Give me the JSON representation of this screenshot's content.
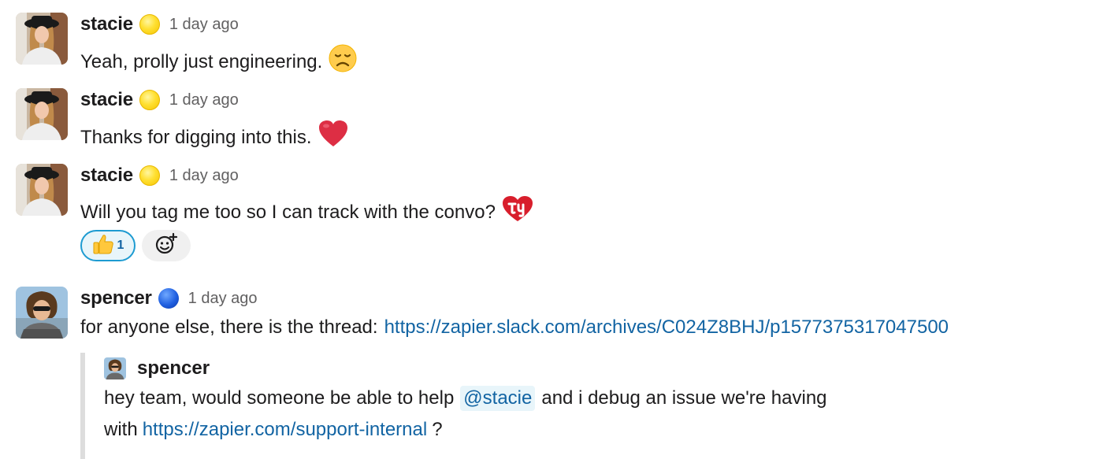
{
  "messages": [
    {
      "author": "stacie",
      "time": "1 day ago",
      "text": "Yeah, prolly just engineering."
    },
    {
      "author": "stacie",
      "time": "1 day ago",
      "text": "Thanks for digging into this."
    },
    {
      "author": "stacie",
      "time": "1 day ago",
      "text": "Will you tag me too so I can track with the convo?",
      "reactions": [
        {
          "emoji": "thumbs-up",
          "count": "1"
        }
      ]
    },
    {
      "author": "spencer",
      "time": "1 day ago",
      "text": "for anyone else, there is the thread:",
      "link": "https://zapier.slack.com/archives/C024Z8BHJ/p1577375317047500"
    }
  ],
  "quote": {
    "author": "spencer",
    "line1_pre": "hey team, would someone be able to help",
    "mention": "@stacie",
    "line1_post": "and i debug an issue we're having",
    "line2_pre": "with",
    "link": "https://zapier.com/support-internal",
    "line2_post": "?"
  },
  "icons": {
    "status_stacie": "yellow-circle",
    "status_spencer": "blue-circle",
    "emoji_1": "disappointed-face",
    "emoji_2": "red-heart",
    "emoji_3": "ty-heart",
    "add_reaction": "add-reaction-icon"
  },
  "colors": {
    "link": "#1264a3",
    "reaction_active_border": "#1d9bd1",
    "timestamp": "#616061"
  }
}
